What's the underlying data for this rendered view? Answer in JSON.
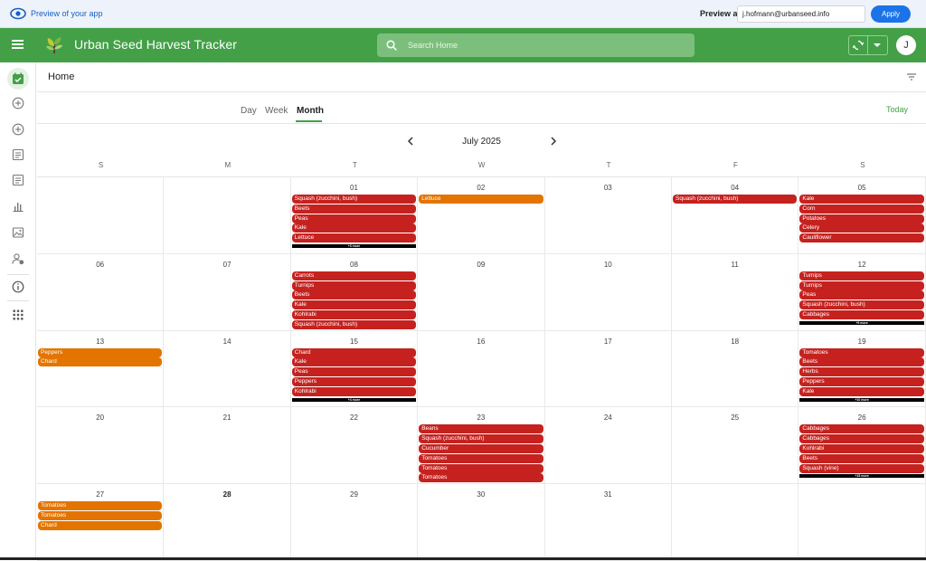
{
  "preview": {
    "title": "Preview of your app",
    "label": "Preview as:",
    "email": "j.hofmann@urbanseed.info",
    "apply": "Apply"
  },
  "appbar": {
    "title": "Urban Seed Harvest Tracker",
    "search_placeholder": "Search Home",
    "avatar_initial": "J"
  },
  "page": {
    "title": "Home"
  },
  "views": {
    "day": "Day",
    "week": "Week",
    "month": "Month",
    "today": "Today"
  },
  "calendar": {
    "month_label": "July 2025",
    "weekdays": [
      "S",
      "M",
      "T",
      "W",
      "T",
      "F",
      "S"
    ],
    "weeks": [
      [
        {
          "num": "",
          "events": []
        },
        {
          "num": "",
          "events": []
        },
        {
          "num": "01",
          "events": [
            {
              "label": "Squash (zucchini, bush)",
              "color": "#c5221f"
            },
            {
              "label": "Beets",
              "color": "#c5221f"
            },
            {
              "label": "Peas",
              "color": "#c5221f"
            },
            {
              "label": "Kale",
              "color": "#c5221f"
            },
            {
              "label": "Lettuce",
              "color": "#c5221f"
            }
          ],
          "more": "+3 more"
        },
        {
          "num": "02",
          "events": [
            {
              "label": "Lettuce",
              "color": "#e37400"
            }
          ]
        },
        {
          "num": "03",
          "events": []
        },
        {
          "num": "04",
          "events": [
            {
              "label": "Squash (zucchini, bush)",
              "color": "#c5221f"
            }
          ]
        },
        {
          "num": "05",
          "events": [
            {
              "label": "Kale",
              "color": "#c5221f"
            },
            {
              "label": "Corn",
              "color": "#c5221f"
            },
            {
              "label": "Potatoes",
              "color": "#c5221f"
            },
            {
              "label": "Celery",
              "color": "#c5221f"
            },
            {
              "label": "Cauliflower",
              "color": "#c5221f"
            }
          ]
        }
      ],
      [
        {
          "num": "06",
          "events": []
        },
        {
          "num": "07",
          "events": []
        },
        {
          "num": "08",
          "events": [
            {
              "label": "Carrots",
              "color": "#c5221f"
            },
            {
              "label": "Turnips",
              "color": "#c5221f"
            },
            {
              "label": "Beets",
              "color": "#c5221f"
            },
            {
              "label": "Kale",
              "color": "#c5221f"
            },
            {
              "label": "Kohlrabi",
              "color": "#c5221f"
            },
            {
              "label": "Squash (zucchini, bush)",
              "color": "#c5221f"
            }
          ]
        },
        {
          "num": "09",
          "events": []
        },
        {
          "num": "10",
          "events": []
        },
        {
          "num": "11",
          "events": []
        },
        {
          "num": "12",
          "events": [
            {
              "label": "Turnips",
              "color": "#c5221f"
            },
            {
              "label": "Turnips",
              "color": "#c5221f"
            },
            {
              "label": "Peas",
              "color": "#c5221f"
            },
            {
              "label": "Squash (zucchini, bush)",
              "color": "#c5221f"
            },
            {
              "label": "Cabbages",
              "color": "#c5221f"
            }
          ],
          "more": "+9 more"
        }
      ],
      [
        {
          "num": "13",
          "events": [
            {
              "label": "Peppers",
              "color": "#e37400"
            },
            {
              "label": "Chard",
              "color": "#e37400"
            }
          ]
        },
        {
          "num": "14",
          "events": []
        },
        {
          "num": "15",
          "events": [
            {
              "label": "Chard",
              "color": "#c5221f"
            },
            {
              "label": "Kale",
              "color": "#c5221f"
            },
            {
              "label": "Peas",
              "color": "#c5221f"
            },
            {
              "label": "Peppers",
              "color": "#c5221f"
            },
            {
              "label": "Kohlrabi",
              "color": "#c5221f"
            }
          ],
          "more": "+4 more"
        },
        {
          "num": "16",
          "events": []
        },
        {
          "num": "17",
          "events": []
        },
        {
          "num": "18",
          "events": []
        },
        {
          "num": "19",
          "events": [
            {
              "label": "Tomatoes",
              "color": "#c5221f"
            },
            {
              "label": "Beets",
              "color": "#c5221f"
            },
            {
              "label": "Herbs",
              "color": "#c5221f"
            },
            {
              "label": "Peppers",
              "color": "#c5221f"
            },
            {
              "label": "Kale",
              "color": "#c5221f"
            }
          ],
          "more": "+10 more"
        }
      ],
      [
        {
          "num": "20",
          "events": []
        },
        {
          "num": "21",
          "events": []
        },
        {
          "num": "22",
          "events": []
        },
        {
          "num": "23",
          "events": [
            {
              "label": "Beans",
              "color": "#c5221f"
            },
            {
              "label": "Squash (zucchini, bush)",
              "color": "#c5221f"
            },
            {
              "label": "Cucumber",
              "color": "#c5221f"
            },
            {
              "label": "Tomatoes",
              "color": "#c5221f"
            },
            {
              "label": "Tomatoes",
              "color": "#c5221f"
            },
            {
              "label": "Tomatoes",
              "color": "#c5221f"
            }
          ]
        },
        {
          "num": "24",
          "events": []
        },
        {
          "num": "25",
          "events": []
        },
        {
          "num": "26",
          "events": [
            {
              "label": "Cabbages",
              "color": "#c5221f"
            },
            {
              "label": "Cabbages",
              "color": "#c5221f"
            },
            {
              "label": "Kohlrabi",
              "color": "#c5221f"
            },
            {
              "label": "Beets",
              "color": "#c5221f"
            },
            {
              "label": "Squash (vine)",
              "color": "#c5221f"
            }
          ],
          "more": "+15 more"
        }
      ],
      [
        {
          "num": "27",
          "events": [
            {
              "label": "Tomatoes",
              "color": "#e37400"
            },
            {
              "label": "Tomatoes",
              "color": "#e37400"
            },
            {
              "label": "Chard",
              "color": "#e37400"
            }
          ]
        },
        {
          "num": "28",
          "events": [],
          "today": true
        },
        {
          "num": "29",
          "events": []
        },
        {
          "num": "30",
          "events": []
        },
        {
          "num": "31",
          "events": []
        },
        {
          "num": "",
          "events": []
        },
        {
          "num": "",
          "events": []
        }
      ]
    ]
  },
  "sidebar": {
    "items": [
      {
        "icon": "calendar-check-icon",
        "active": true
      },
      {
        "icon": "add-circle-icon"
      },
      {
        "icon": "add-circle-icon"
      },
      {
        "icon": "list-document-icon"
      },
      {
        "icon": "list-document-icon"
      },
      {
        "icon": "bar-chart-icon"
      },
      {
        "icon": "image-icon"
      },
      {
        "icon": "user-settings-icon"
      },
      {
        "icon": "info-icon"
      },
      {
        "icon": "apps-grid-icon"
      }
    ]
  },
  "colors": {
    "brand": "#43a047",
    "event_red": "#c5221f",
    "event_orange": "#e37400",
    "apply_blue": "#1a73e8"
  }
}
